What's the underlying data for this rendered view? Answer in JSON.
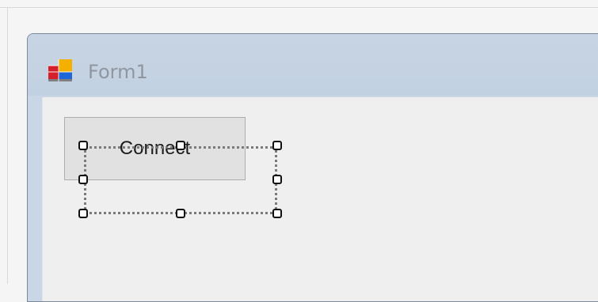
{
  "form": {
    "title": "Form1",
    "icon": "form-app-icon"
  },
  "button": {
    "label": "Connect",
    "selected": true
  },
  "selection": {
    "handles": [
      "top-left-resize-handle",
      "top-center-resize-handle",
      "top-right-resize-handle",
      "middle-left-resize-handle",
      "middle-right-resize-handle",
      "bottom-left-resize-handle",
      "bottom-center-resize-handle",
      "bottom-right-resize-handle"
    ]
  },
  "colors": {
    "title_bar": "#c2d1e2",
    "client_area": "#efefef",
    "button_face": "#e1e1e1",
    "button_border": "#adadad",
    "title_text": "#8f96a0"
  }
}
